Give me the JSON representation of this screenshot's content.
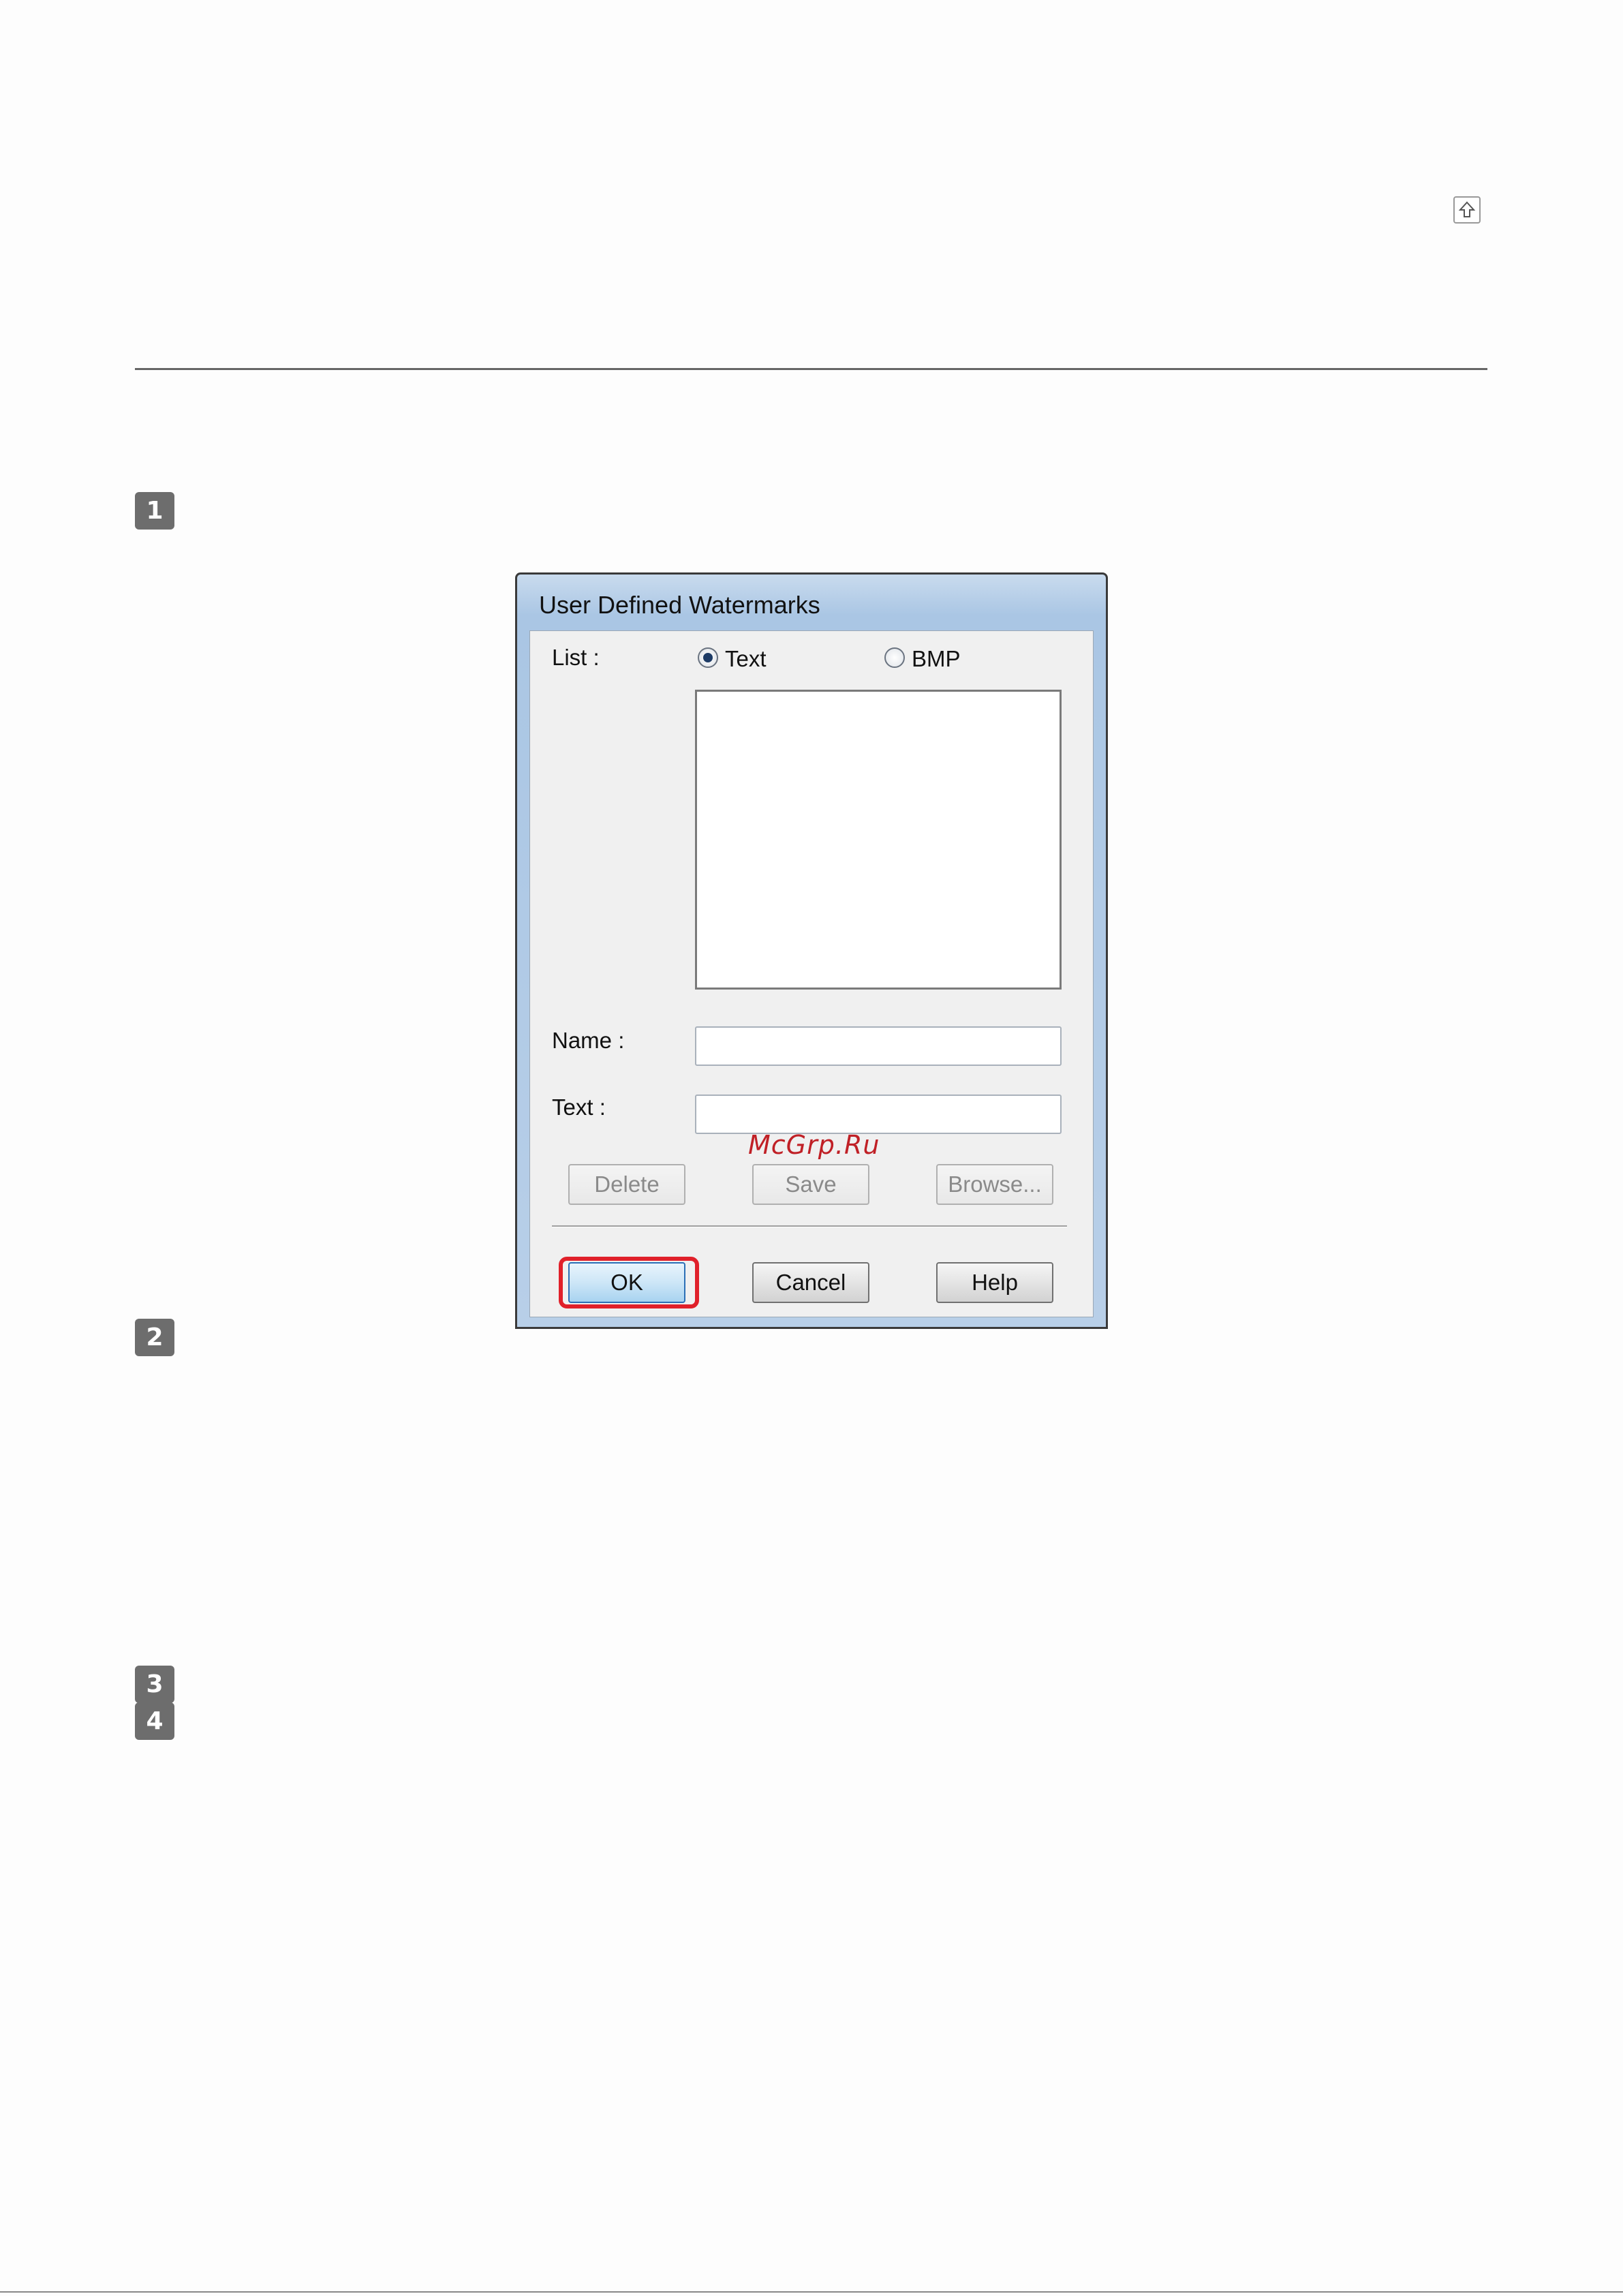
{
  "steps": [
    "1",
    "2",
    "3",
    "4"
  ],
  "dialog": {
    "title": "User Defined Watermarks",
    "list_label": "List :",
    "radio_text": "Text",
    "radio_bmp": "BMP",
    "name_label": "Name :",
    "text_label": "Text :",
    "name_value": "",
    "text_value": "",
    "buttons": {
      "delete": "Delete",
      "save": "Save",
      "browse": "Browse...",
      "ok": "OK",
      "cancel": "Cancel",
      "help": "Help"
    }
  },
  "watermark": "McGrp.Ru",
  "icons": {
    "top": "back-to-top-icon"
  },
  "colors": {
    "highlight": "#e0202a",
    "badge": "#6d6d6d"
  }
}
